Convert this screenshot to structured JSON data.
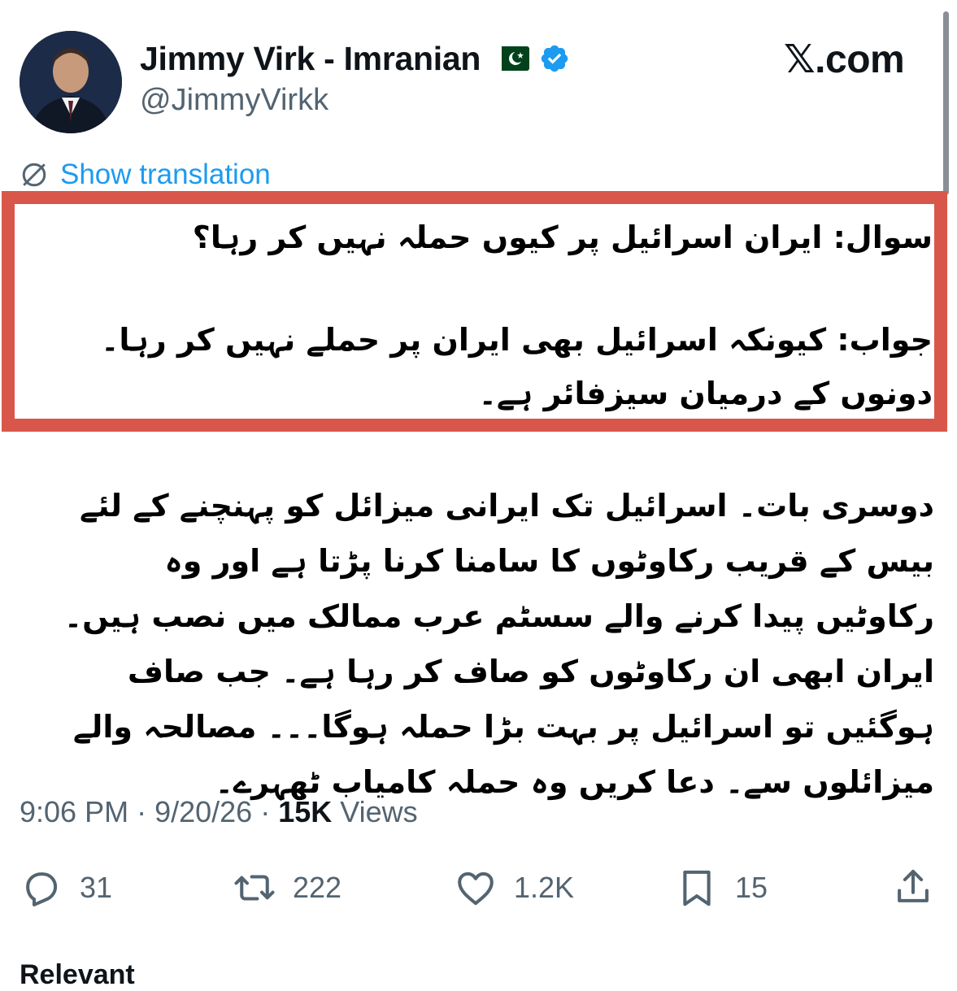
{
  "author": {
    "display_name": "Jimmy Virk - Imranian",
    "handle": "@JimmyVirkk",
    "flag_icon": "pakistan-flag",
    "verified_color": "#1d9bf0"
  },
  "site_label": "𝕏.com",
  "translate": {
    "label": "Show translation"
  },
  "highlight_color": "#d9574a",
  "post": {
    "question": "سوال: ایران اسرائیل پر کیوں حملہ نہیں کر رہا؟",
    "answer": "جواب: کیونکہ اسرائیل بھی ایران پر حملے نہیں کر رہا۔ دونوں کے درمیان سیزفائر ہے۔",
    "body": "دوسری بات۔ اسرائیل تک ایرانی میزائل کو پہنچنے کے لئے بیس کے قریب رکاوٹوں کا سامنا کرنا پڑتا ہے اور وہ رکاوٹیں پیدا کرنے والے سسٹم عرب ممالک میں نصب ہیں۔ ایران ابھی ان رکاوٹوں کو صاف کر رہا ہے۔ جب صاف ہوگئیں تو اسرائیل پر بہت بڑا حملہ ہوگا۔۔۔ مصالحہ والے میزائلوں سے۔ دعا کریں وہ حملہ کامیاب ٹھہرے۔"
  },
  "meta": {
    "time": "9:06 PM",
    "date": "9/20/26",
    "views_count": "15K",
    "views_label": "Views"
  },
  "actions": {
    "replies": "31",
    "reposts": "222",
    "likes": "1.2K",
    "bookmarks": "15"
  },
  "relevant_label": "Relevant"
}
